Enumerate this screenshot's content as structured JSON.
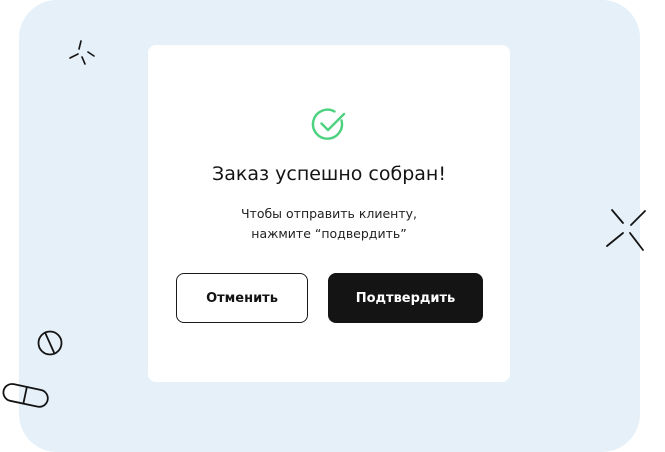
{
  "dialog": {
    "title": "Заказ успешно собран!",
    "message_line1": "Чтобы отправить клиенту,",
    "message_line2": "нажмите “подвердить”",
    "cancel_label": "Отменить",
    "confirm_label": "Подтвердить",
    "success_icon": "check-circle-icon"
  },
  "colors": {
    "backdrop": "#e5f0f9",
    "dialog": "#ffffff",
    "success": "#4cd17f",
    "confirm_button": "#141414",
    "text": "#141414"
  },
  "decorations": [
    "sparkle-icon",
    "sparkle-icon",
    "pill-round-icon",
    "capsule-icon"
  ]
}
